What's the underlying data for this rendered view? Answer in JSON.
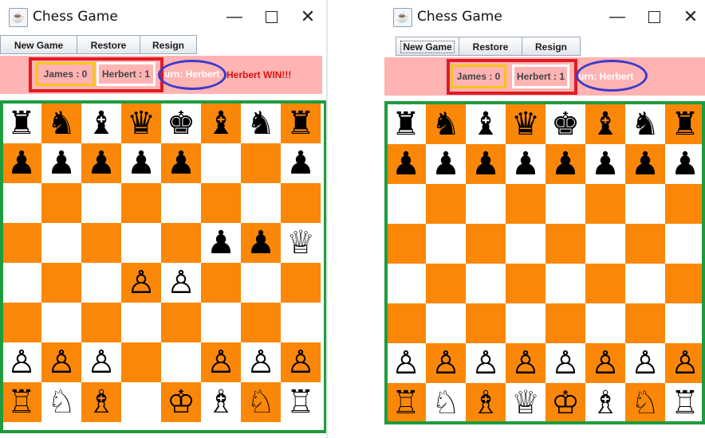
{
  "colors": {
    "dark_square": "#fb8708",
    "light_square": "#ffffff",
    "status_bg": "#ffb3b3",
    "annot_red": "#e01b22",
    "annot_blue": "#3b3bcc",
    "annot_green": "#1f9b3e",
    "score1_border": "#f5c518",
    "score2_border": "#ffffff"
  },
  "windows": [
    {
      "title": "Chess Game",
      "toolbar": {
        "new_game": "New Game",
        "restore": "Restore",
        "resign": "Resign"
      },
      "status": {
        "score1": "James : 0",
        "score2": "Herbert : 1",
        "turn": "urn: Herbert",
        "message": "Herbert WIN!!!"
      },
      "board": [
        [
          "♜",
          "♞",
          "♝",
          "♛",
          "♚",
          "♝",
          "♞",
          "♜"
        ],
        [
          "♟",
          "♟",
          "♟",
          "♟",
          "♟",
          "",
          "",
          "♟"
        ],
        [
          "",
          "",
          "",
          "",
          "",
          "",
          "",
          ""
        ],
        [
          "",
          "",
          "",
          "",
          "",
          "♟",
          "♟",
          "♕"
        ],
        [
          "",
          "",
          "",
          "♙",
          "♙",
          "",
          "",
          ""
        ],
        [
          "",
          "",
          "",
          "",
          "",
          "",
          "",
          ""
        ],
        [
          "♙",
          "♙",
          "♙",
          "",
          "",
          "♙",
          "♙",
          "♙"
        ],
        [
          "♖",
          "♘",
          "♗",
          "",
          "♔",
          "♗",
          "♘",
          "♖"
        ]
      ]
    },
    {
      "title": "Chess Game",
      "toolbar": {
        "new_game": "New Game",
        "restore": "Restore",
        "resign": "Resign"
      },
      "status": {
        "score1": "James : 0",
        "score2": "Herbert : 1",
        "turn": "urn: Herbert",
        "message": ""
      },
      "board": [
        [
          "♜",
          "♞",
          "♝",
          "♛",
          "♚",
          "♝",
          "♞",
          "♜"
        ],
        [
          "♟",
          "♟",
          "♟",
          "♟",
          "♟",
          "♟",
          "♟",
          "♟"
        ],
        [
          "",
          "",
          "",
          "",
          "",
          "",
          "",
          ""
        ],
        [
          "",
          "",
          "",
          "",
          "",
          "",
          "",
          ""
        ],
        [
          "",
          "",
          "",
          "",
          "",
          "",
          "",
          ""
        ],
        [
          "",
          "",
          "",
          "",
          "",
          "",
          "",
          ""
        ],
        [
          "♙",
          "♙",
          "♙",
          "♙",
          "♙",
          "♙",
          "♙",
          "♙"
        ],
        [
          "♖",
          "♘",
          "♗",
          "♕",
          "♔",
          "♗",
          "♘",
          "♖"
        ]
      ]
    }
  ]
}
